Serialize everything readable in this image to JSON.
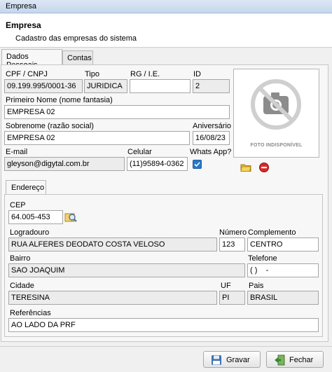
{
  "window": {
    "title": "Empresa"
  },
  "header": {
    "title": "Empresa",
    "subtitle": "Cadastro das empresas do sistema"
  },
  "tabs": [
    {
      "label": "Dados Pessoais"
    },
    {
      "label": "Contas"
    }
  ],
  "form": {
    "cpf_label": "CPF  / CNPJ",
    "cpf_value": "09.199.995/0001-36",
    "tipo_label": "Tipo",
    "tipo_value": "JURIDICA",
    "rg_label": "RG / I.E.",
    "rg_value": "",
    "id_label": "ID",
    "id_value": "2",
    "primeiro_nome_label": "Primeiro Nome (nome fantasia)",
    "primeiro_nome_value": "EMPRESA 02",
    "sobrenome_label": "Sobrenome (razão social)",
    "sobrenome_value": "EMPRESA 02",
    "aniversario_label": "Aniversário",
    "aniversario_value": "16/08/23",
    "email_label": "E-mail",
    "email_value": "gleyson@digytal.com.br",
    "celular_label": "Celular",
    "celular_value": "(11)95894-0362",
    "whatsapp_label": "Whats App?",
    "whatsapp_checked": true
  },
  "photo": {
    "caption": "FOTO INDISPONÍVEL",
    "open_icon": "folder-icon",
    "remove_icon": "remove-icon"
  },
  "endereco": {
    "tab_label": "Endereço",
    "cep_label": "CEP",
    "cep_value": "64.005-453",
    "logradouro_label": "Logradouro",
    "logradouro_value": "RUA ALFERES DEODATO COSTA VELOSO",
    "numero_label": "Número",
    "numero_value": "123",
    "complemento_label": "Complemento",
    "complemento_value": "CENTRO",
    "bairro_label": "Bairro",
    "bairro_value": "SAO JOAQUIM",
    "telefone_label": "Telefone",
    "telefone_value": "( )    -",
    "cidade_label": "Cidade",
    "cidade_value": "TERESINA",
    "uf_label": "UF",
    "uf_value": "PI",
    "pais_label": "Pais",
    "pais_value": "BRASIL",
    "referencias_label": "Referências",
    "referencias_value": "AO LADO DA PRF"
  },
  "footer": {
    "save_label": "Gravar",
    "close_label": "Fechar"
  }
}
